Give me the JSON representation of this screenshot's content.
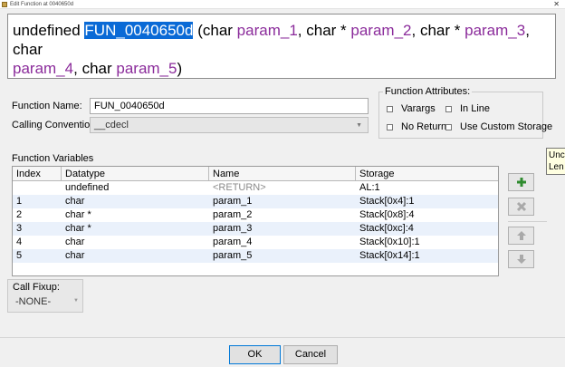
{
  "window": {
    "title": "Edit Function at 0040650d",
    "close_glyph": "✕"
  },
  "signature": {
    "return_type": "undefined",
    "function_name": "FUN_0040650d",
    "open_paren": "(",
    "close_paren": ")",
    "params": [
      {
        "type": "char",
        "name": "param_1",
        "sep": ", "
      },
      {
        "type": "char *",
        "name": "param_2",
        "sep": ", "
      },
      {
        "type": "char *",
        "name": "param_3",
        "sep": ", "
      },
      {
        "type": "char",
        "name": "param_4",
        "sep": ", "
      },
      {
        "type": "char",
        "name": "param_5",
        "sep": ""
      }
    ],
    "selection_color": "#0a6ad6",
    "param_color": "#8b2c9b"
  },
  "form": {
    "function_name_label": "Function Name:",
    "function_name_value": "FUN_0040650d",
    "calling_convention_label": "Calling Convention",
    "calling_convention_value": "__cdecl"
  },
  "attributes": {
    "legend": "Function Attributes:",
    "varargs": {
      "label": "Varargs",
      "checked": false
    },
    "inline": {
      "label": "In Line",
      "checked": false
    },
    "noreturn": {
      "label": "No Return",
      "checked": false
    },
    "custom_storage": {
      "label": "Use Custom Storage",
      "checked": false
    }
  },
  "variables": {
    "section_label": "Function Variables",
    "columns": [
      "Index",
      "Datatype",
      "Name",
      "Storage"
    ],
    "rows": [
      {
        "index": "",
        "datatype": "undefined",
        "name": "<RETURN>",
        "storage": "AL:1"
      },
      {
        "index": "1",
        "datatype": "char",
        "name": "param_1",
        "storage": "Stack[0x4]:1"
      },
      {
        "index": "2",
        "datatype": "char *",
        "name": "param_2",
        "storage": "Stack[0x8]:4"
      },
      {
        "index": "3",
        "datatype": "char *",
        "name": "param_3",
        "storage": "Stack[0xc]:4"
      },
      {
        "index": "4",
        "datatype": "char",
        "name": "param_4",
        "storage": "Stack[0x10]:1"
      },
      {
        "index": "5",
        "datatype": "char",
        "name": "param_5",
        "storage": "Stack[0x14]:1"
      }
    ]
  },
  "side_buttons": {
    "add_icon": "plus-icon",
    "remove_icon": "x-icon",
    "up_icon": "arrow-up-icon",
    "down_icon": "arrow-down-icon",
    "add_color": "#2e8b2e"
  },
  "tooltip": {
    "line1": "Unc",
    "line2": "Len"
  },
  "call_fixup": {
    "label": "Call Fixup:",
    "value": "-NONE-"
  },
  "buttons": {
    "ok": "OK",
    "cancel": "Cancel"
  }
}
